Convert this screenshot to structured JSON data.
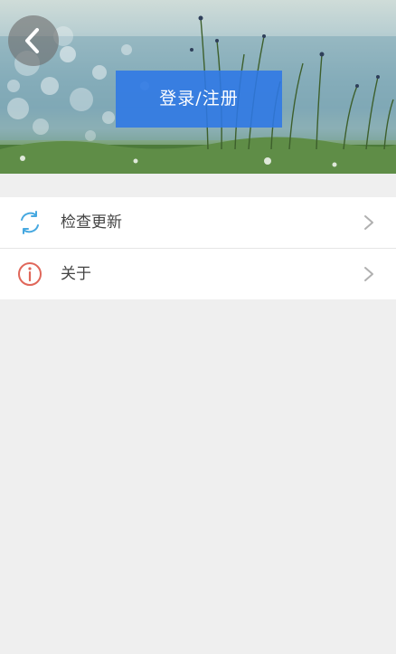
{
  "header": {
    "login_label": "登录/注册"
  },
  "menu": {
    "items": [
      {
        "label": "检查更新",
        "icon": "refresh-icon",
        "icon_color": "#46a8e0"
      },
      {
        "label": "关于",
        "icon": "info-icon",
        "icon_color": "#e0675a"
      }
    ]
  },
  "colors": {
    "accent": "#2d78e6",
    "background": "#efefef",
    "chevron": "#b0b0b0"
  }
}
